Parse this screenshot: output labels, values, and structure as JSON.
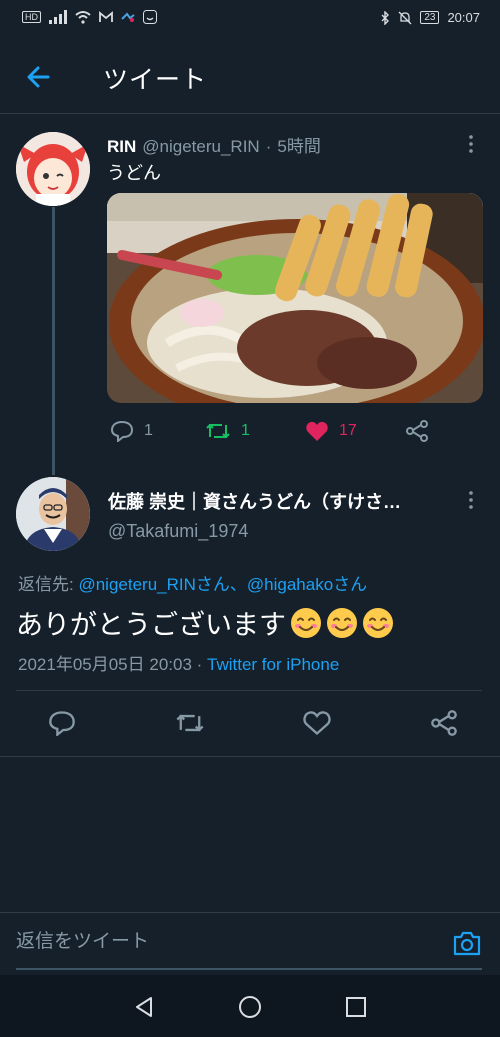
{
  "status_bar": {
    "hd": "HD",
    "time": "20:07",
    "battery": "23"
  },
  "header": {
    "title": "ツイート"
  },
  "tweet1": {
    "name": "RIN",
    "handle": "@nigeteru_RIN",
    "dot": "·",
    "time": "5時間",
    "text": "うどん",
    "replies": "1",
    "retweets": "1",
    "likes": "17"
  },
  "tweet2": {
    "name": "佐藤 崇史｜資さんうどん（すけさ…",
    "handle": "@Takafumi_1974",
    "reply_prefix": "返信先: ",
    "reply_user1": "@nigeteru_RINさん",
    "reply_sep": "、",
    "reply_user2": "@higahakoさん",
    "text": "ありがとうございます",
    "date": "2021年05月05日 20:03",
    "dot": " · ",
    "source": "Twitter for iPhone"
  },
  "compose": {
    "placeholder": "返信をツイート"
  },
  "colors": {
    "background": "#15202b",
    "accent": "#1da1f2",
    "muted": "#8899a6",
    "retweet": "#17bf63",
    "like": "#e0245e"
  }
}
